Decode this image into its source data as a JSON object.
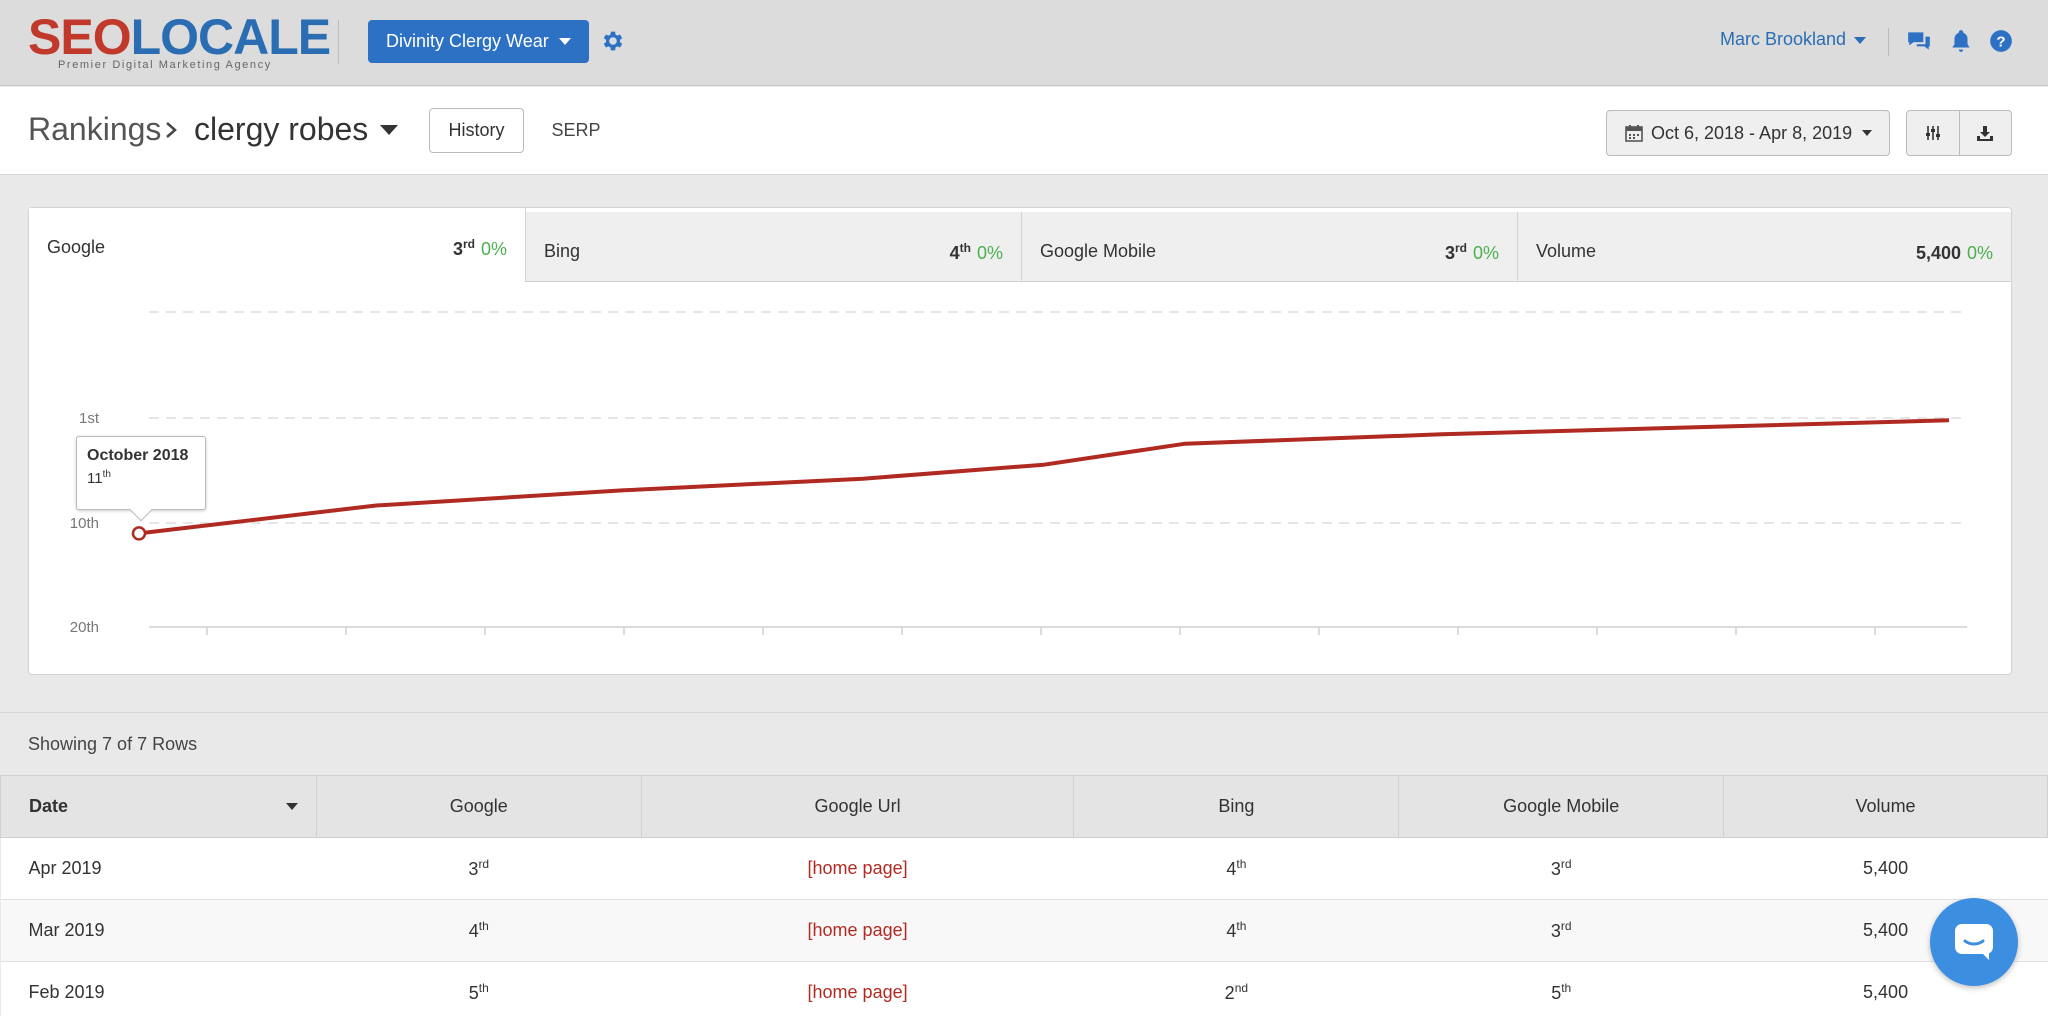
{
  "brand": {
    "word_a": "SEO",
    "word_b": "LOCALE",
    "tagline": "Premier Digital Marketing Agency",
    "red": "#c0392b",
    "blue": "#2a6db3"
  },
  "topbar": {
    "client_label": "Divinity Clergy Wear",
    "user_name": "Marc Brookland",
    "icons": [
      "gear-icon",
      "chat-icon",
      "bell-icon",
      "help-icon"
    ]
  },
  "header": {
    "section": "Rankings",
    "keyword": "clergy robes",
    "history_label": "History",
    "serp_label": "SERP",
    "date_range": "Oct 6, 2018 - Apr 8, 2019"
  },
  "tabs": [
    {
      "label": "Google",
      "rank": "3",
      "suffix": "rd",
      "change": "0%"
    },
    {
      "label": "Bing",
      "rank": "4",
      "suffix": "th",
      "change": "0%"
    },
    {
      "label": "Google Mobile",
      "rank": "3",
      "suffix": "rd",
      "change": "0%"
    },
    {
      "label": "Volume",
      "rank": "5,400",
      "suffix": "",
      "change": "0%"
    }
  ],
  "chart_data": {
    "type": "line",
    "series": [
      {
        "values": [
          11,
          8.5,
          7.2,
          6.2,
          5.0,
          3.2,
          2.4,
          1.8,
          1.2
        ]
      }
    ],
    "x_positions": [
      0,
      0.17,
      0.34,
      0.5,
      0.5,
      0.67,
      0.79,
      0.9,
      1.0
    ],
    "y_axis": {
      "ticks": [
        "1st",
        "10th",
        "20th"
      ],
      "reversed": true
    },
    "grid": true,
    "line_color": "#b02a22",
    "tooltip": {
      "title": "October 2018",
      "value": "11",
      "suffix": "th"
    }
  },
  "table": {
    "showing": "Showing 7 of 7 Rows",
    "columns": [
      "Date",
      "Google",
      "Google Url",
      "Bing",
      "Google Mobile",
      "Volume"
    ],
    "rows": [
      {
        "date": "Apr 2019",
        "google": "3",
        "google_suf": "rd",
        "url": "[home page]",
        "bing": "4",
        "bing_suf": "th",
        "mobile": "3",
        "mobile_suf": "rd",
        "volume": "5,400"
      },
      {
        "date": "Mar 2019",
        "google": "4",
        "google_suf": "th",
        "url": "[home page]",
        "bing": "4",
        "bing_suf": "th",
        "mobile": "3",
        "mobile_suf": "rd",
        "volume": "5,400"
      },
      {
        "date": "Feb 2019",
        "google": "5",
        "google_suf": "th",
        "url": "[home page]",
        "bing": "2",
        "bing_suf": "nd",
        "mobile": "5",
        "mobile_suf": "th",
        "volume": "5,400"
      }
    ]
  }
}
